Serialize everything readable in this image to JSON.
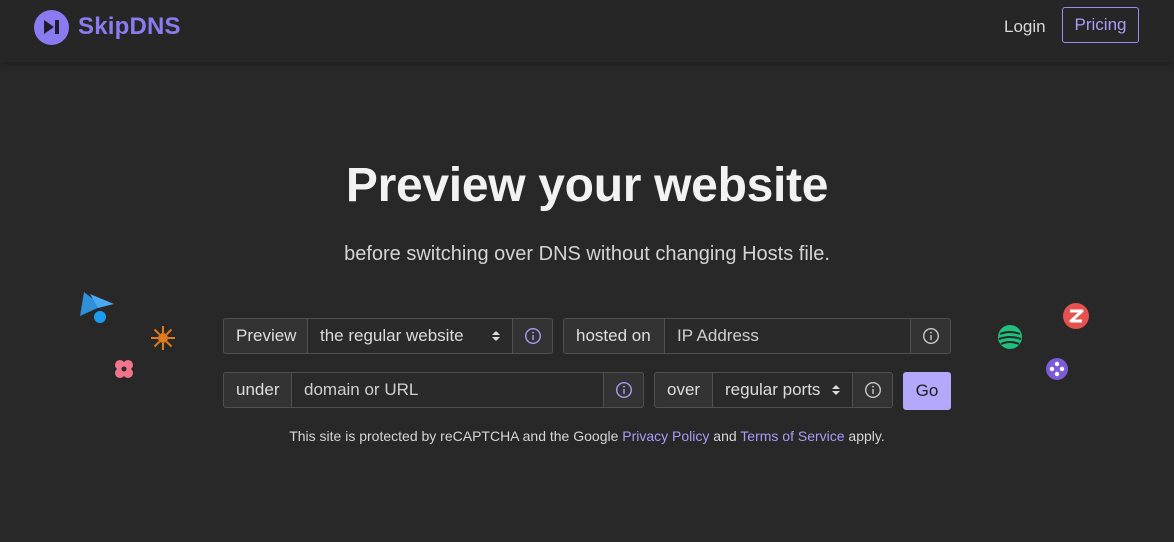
{
  "brand": {
    "name": "SkipDNS",
    "color": "#8b7bf0"
  },
  "nav": {
    "login": "Login",
    "pricing": "Pricing"
  },
  "hero": {
    "title": "Preview your website",
    "subtitle": "before switching over DNS without changing Hosts file."
  },
  "form": {
    "preview_label": "Preview",
    "mode_value": "the regular website",
    "hosted_label": "hosted on",
    "ip_placeholder": "IP Address",
    "under_label": "under",
    "domain_placeholder": "domain or URL",
    "over_label": "over",
    "ports_value": "regular ports",
    "go_label": "Go"
  },
  "recaptcha": {
    "prefix": "This site is protected by reCAPTCHA and the Google ",
    "privacy": "Privacy Policy",
    "and": " and ",
    "terms": "Terms of Service",
    "suffix": " apply."
  },
  "icons": [
    "skipdns-logo-icon",
    "info-icon",
    "select-arrow-icon",
    "provider-logo-icon"
  ],
  "colors": {
    "background": "#282828",
    "accent": "#a99cf7",
    "go_button": "#b3a8fa"
  }
}
